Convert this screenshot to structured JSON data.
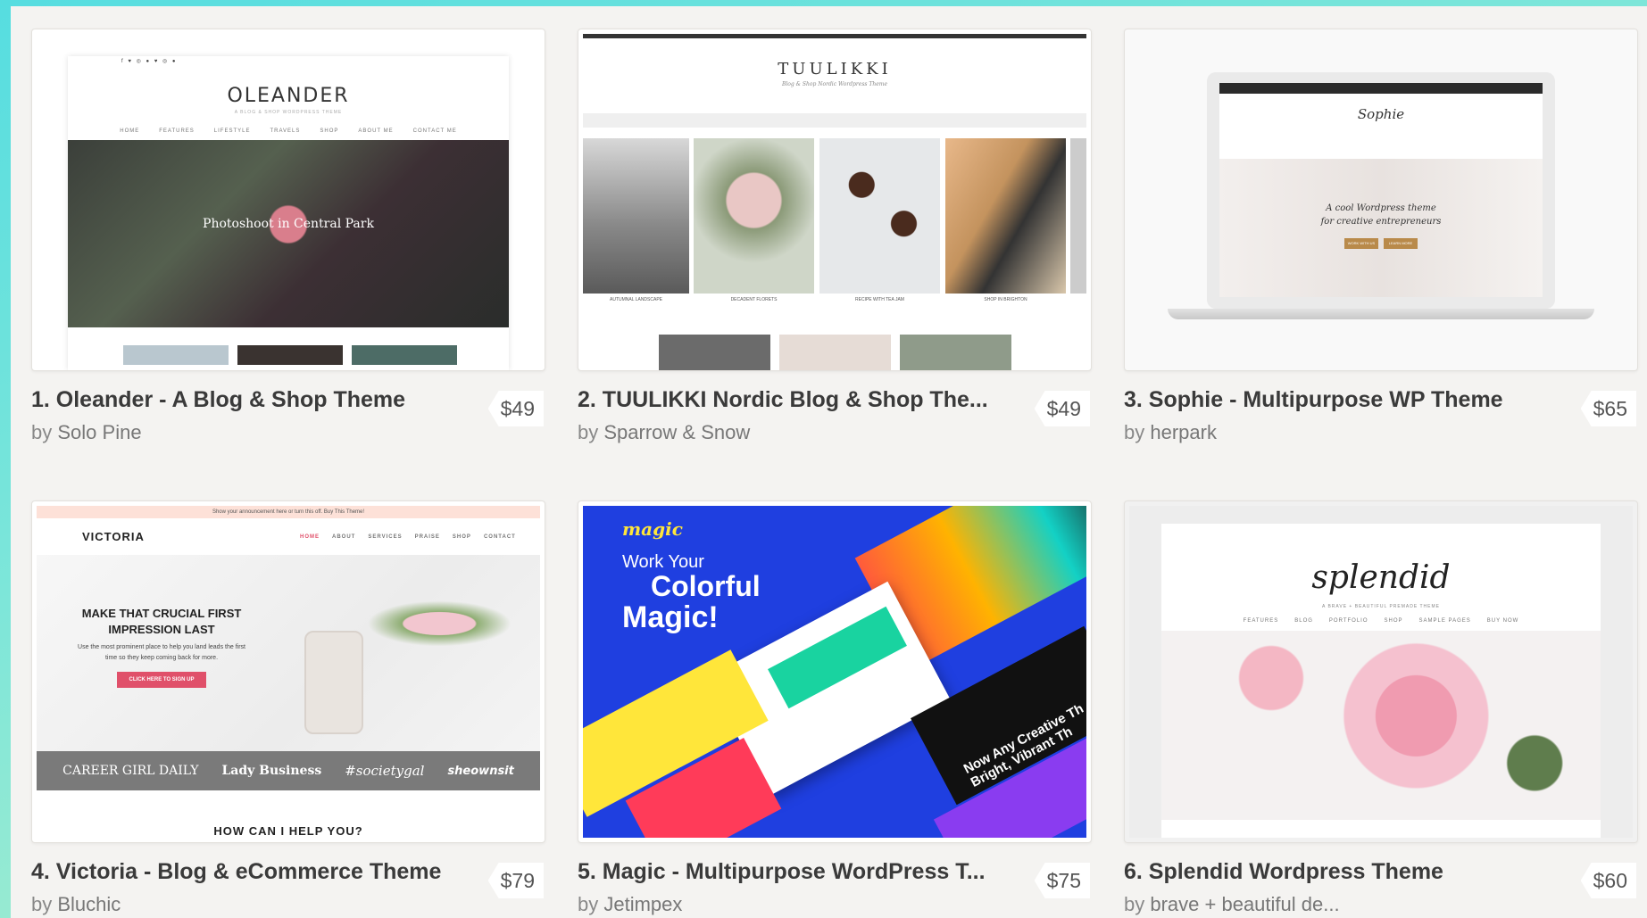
{
  "items": [
    {
      "title": "1. Oleander - A Blog & Shop Theme",
      "by": "by",
      "author": "Solo Pine",
      "price": "$49",
      "preview": {
        "brand": "OLEANDER",
        "tagline": "A BLOG & SHOP WORDPRESS THEME",
        "hero_title": "Photoshoot in Central Park",
        "nav": [
          "HOME",
          "FEATURES",
          "LIFESTYLE",
          "TRAVELS",
          "SHOP",
          "ABOUT ME",
          "CONTACT ME"
        ]
      }
    },
    {
      "title": "2. TUULIKKI Nordic Blog & Shop The...",
      "by": "by",
      "author": "Sparrow & Snow",
      "price": "$49",
      "preview": {
        "brand": "TUULIKKI",
        "tagline": "Blog & Shop Nordic Wordpress Theme",
        "captions": [
          "AUTUMNAL LANDSCAPE",
          "DECADENT FLORETS",
          "RECIPE WITH TEA JAM",
          "SHOP IN BRIGHTON"
        ]
      }
    },
    {
      "title": "3. Sophie - Multipurpose WP Theme",
      "by": "by",
      "author": "herpark",
      "price": "$65",
      "preview": {
        "brand": "Sophie",
        "headline_1": "A cool Wordpress theme",
        "headline_2": "for creative entrepreneurs",
        "btn_1": "WORK WITH US",
        "btn_2": "LEARN MORE"
      }
    },
    {
      "title": "4. Victoria - Blog & eCommerce Theme",
      "by": "by",
      "author": "Bluchic",
      "price": "$79",
      "preview": {
        "announcement": "Show your announcement here or turn this off. Buy This Theme!",
        "brand": "VICTORIA",
        "nav": [
          "HOME",
          "ABOUT",
          "SERVICES",
          "PRAISE",
          "SHOP",
          "CONTACT"
        ],
        "headline_1": "MAKE THAT CRUCIAL FIRST",
        "headline_2": "IMPRESSION LAST",
        "sub_1": "Use the most prominent place to help you land leads the first",
        "sub_2": "time so they keep coming back for more.",
        "cta": "CLICK HERE TO SIGN UP",
        "logos": [
          "CAREER GIRL DAILY",
          "Lady Business",
          "#societygal",
          "sheownsit"
        ],
        "bottom": "HOW CAN I HELP YOU?"
      }
    },
    {
      "title": "5. Magic - Multipurpose WordPress T...",
      "by": "by",
      "author": "Jetimpex",
      "price": "$75",
      "preview": {
        "logo": "magic",
        "line_1": "Work Your",
        "line_2": "Colorful",
        "line_3": "Magic!",
        "slanted": "Now Any Creative Th Bright, Vibrant Th"
      }
    },
    {
      "title": "6. Splendid Wordpress Theme",
      "by": "by",
      "author": "brave + beautiful de...",
      "price": "$60",
      "preview": {
        "brand": "splendid",
        "tagline": "A BRAVE + BEAUTIFUL PREMADE THEME",
        "nav": [
          "FEATURES",
          "BLOG",
          "PORTFOLIO",
          "SHOP",
          "SAMPLE PAGES",
          "BUY NOW"
        ]
      }
    }
  ]
}
